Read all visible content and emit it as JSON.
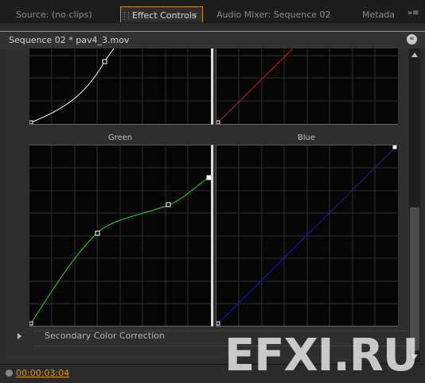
{
  "tabs": [
    {
      "label": "Source: (no clips)"
    },
    {
      "label": "Effect Controls",
      "close": "×"
    },
    {
      "label": "Audio Mixer: Sequence 02"
    },
    {
      "label": "Metada"
    }
  ],
  "panel_menu_glyph": "»≡",
  "header": {
    "title": "Sequence 02 * pav4_3.mov",
    "collapse_glyph": "«"
  },
  "curves": {
    "green_label": "Green",
    "blue_label": "Blue",
    "colors": {
      "top_left": "#ffffff",
      "top_right": "#cc1a1a",
      "green": "#22dd22",
      "blue": "#1a1acc",
      "grid": "#2e2e2e",
      "background": "#050505"
    }
  },
  "section": {
    "label": "Secondary Color Correction"
  },
  "footer": {
    "timecode": "00:00:03:04"
  },
  "watermark": "EFXI.RU",
  "colors": {
    "accent": "#c58b12",
    "timecode": "#d89a18"
  }
}
